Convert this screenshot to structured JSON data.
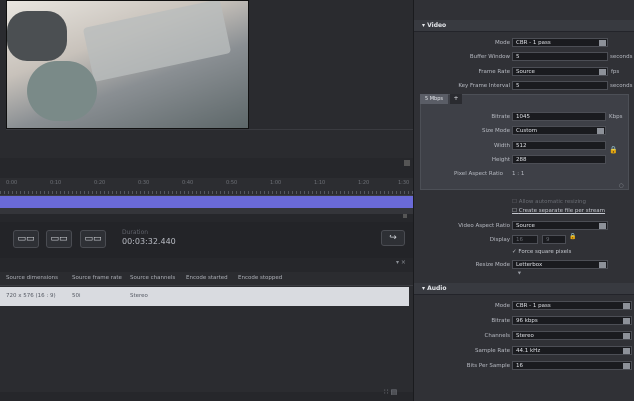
{
  "timeline": {
    "ticks": [
      "0:00",
      "0:10",
      "0:20",
      "0:30",
      "0:40",
      "0:50",
      "1:00",
      "1:10",
      "1:20",
      "1:30"
    ]
  },
  "transport": {
    "btn1_icon": "film-strip-icon",
    "btn2_icon": "film-strip-icon",
    "btn3_icon": "film-strip-icon",
    "duration_label": "Duration",
    "duration_value": "00:03:32.440",
    "export_icon": "export-icon"
  },
  "source_table": {
    "columns": [
      "Source dimensions",
      "Source frame rate",
      "Source channels",
      "Encode started",
      "Encode stopped"
    ],
    "rows": [
      [
        "720 x 576 (16 : 9)",
        "50i",
        "Stereo",
        "",
        ""
      ]
    ]
  },
  "video": {
    "header": "▾ Video",
    "mode_label": "Mode",
    "mode_value": "CBR - 1 pass",
    "buffer_window_label": "Buffer Window",
    "buffer_window_value": "5",
    "buffer_window_unit": "seconds",
    "frame_rate_label": "Frame Rate",
    "frame_rate_value": "Source",
    "frame_rate_unit": "fps",
    "key_frame_label": "Key Frame Interval",
    "key_frame_value": "5",
    "key_frame_unit": "seconds",
    "tab_label": "5 Mbps",
    "tab_add": "+",
    "bitrate_label": "Bitrate",
    "bitrate_value": "1045",
    "bitrate_unit": "Kbps",
    "size_mode_label": "Size Mode",
    "size_mode_value": "Custom",
    "width_label": "Width",
    "width_value": "512",
    "height_label": "Height",
    "height_value": "288",
    "par_label": "Pixel Aspect Ratio",
    "par_value": "1 : 1",
    "allow_resizing": "Allow automatic resizing",
    "create_separate": "Create separate file per stream",
    "var_label": "Video Aspect Ratio",
    "var_value": "Source",
    "display_label": "Display",
    "display_w": "16",
    "display_h": "9",
    "force_square": "Force square pixels",
    "resize_mode_label": "Resize Mode",
    "resize_mode_value": "Letterbox"
  },
  "audio": {
    "header": "▾ Audio",
    "mode_label": "Mode",
    "mode_value": "CBR - 1 pass",
    "bitrate_label": "Bitrate",
    "bitrate_value": "96 kbps",
    "channels_label": "Channels",
    "channels_value": "Stereo",
    "sample_rate_label": "Sample Rate",
    "sample_rate_value": "44.1 kHz",
    "bits_label": "Bits Per Sample",
    "bits_value": "16"
  }
}
